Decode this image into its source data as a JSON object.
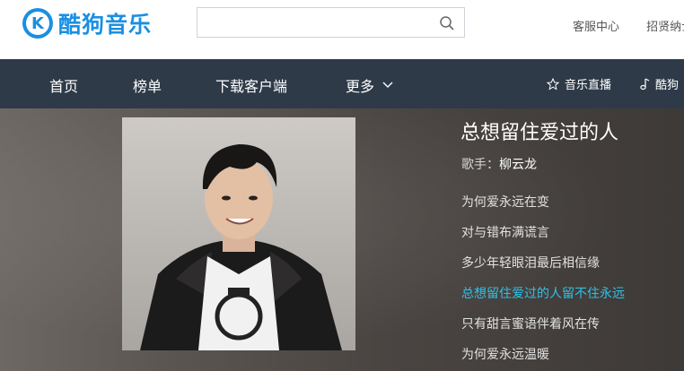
{
  "header": {
    "logo_text": "酷狗音乐",
    "logo_letter": "K",
    "search": {
      "value": "",
      "placeholder": ""
    },
    "links": [
      "客服中心",
      "招贤纳士"
    ]
  },
  "nav": {
    "items": [
      "首页",
      "榜单",
      "下载客户端",
      "更多"
    ],
    "right": [
      "音乐直播",
      "酷狗"
    ]
  },
  "song": {
    "title": "总想留住爱过的人",
    "artist_label": "歌手：",
    "artist": "柳云龙",
    "lyrics": [
      "为何爱永远在变",
      "对与错布满谎言",
      "多少年轻眼泪最后相信缘",
      "总想留住爱过的人留不住永远",
      "只有甜言蜜语伴着风在传",
      "为何爱永远温暖"
    ],
    "active_lyric_index": 3
  },
  "colors": {
    "brand": "#1a8fe3",
    "nav_bg": "#2e3a48",
    "active_lyric": "#2fc1e8"
  }
}
